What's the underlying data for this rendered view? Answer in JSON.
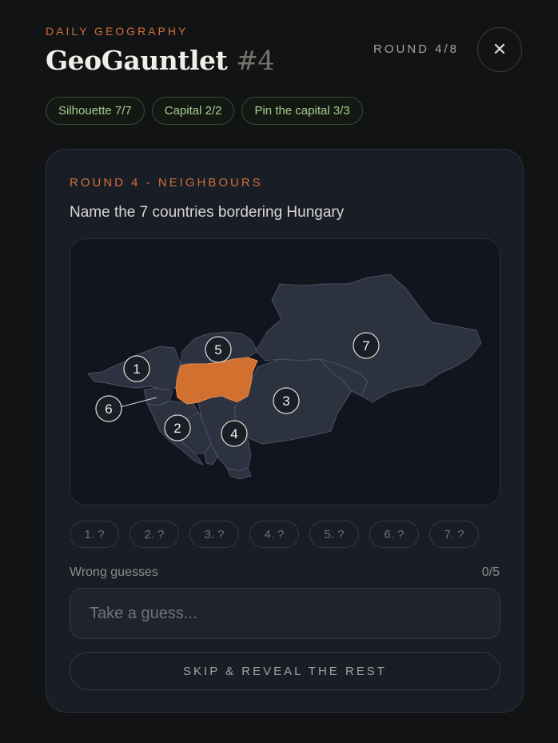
{
  "header": {
    "eyebrow": "DAILY GEOGRAPHY",
    "title": "GeoGauntlet",
    "title_number": "#4",
    "round_label": "ROUND 4/8",
    "close_icon": "close-icon"
  },
  "chips": [
    {
      "label": "Silhouette 7/7"
    },
    {
      "label": "Capital 2/2"
    },
    {
      "label": "Pin the capital 3/3"
    }
  ],
  "card": {
    "eyebrow": "ROUND 4 - NEIGHBOURS",
    "question": "Name the 7 countries bordering Hungary",
    "map": {
      "highlight_color": "#d1702f",
      "country_color": "#2c3240",
      "markers": [
        "1",
        "2",
        "3",
        "4",
        "5",
        "6",
        "7"
      ]
    },
    "slots": [
      "1. ?",
      "2. ?",
      "3. ?",
      "4. ?",
      "5. ?",
      "6. ?",
      "7. ?"
    ],
    "wrong_label": "Wrong guesses",
    "wrong_count": "0/5",
    "guess_placeholder": "Take a guess...",
    "skip_label": "SKIP & REVEAL THE REST"
  }
}
